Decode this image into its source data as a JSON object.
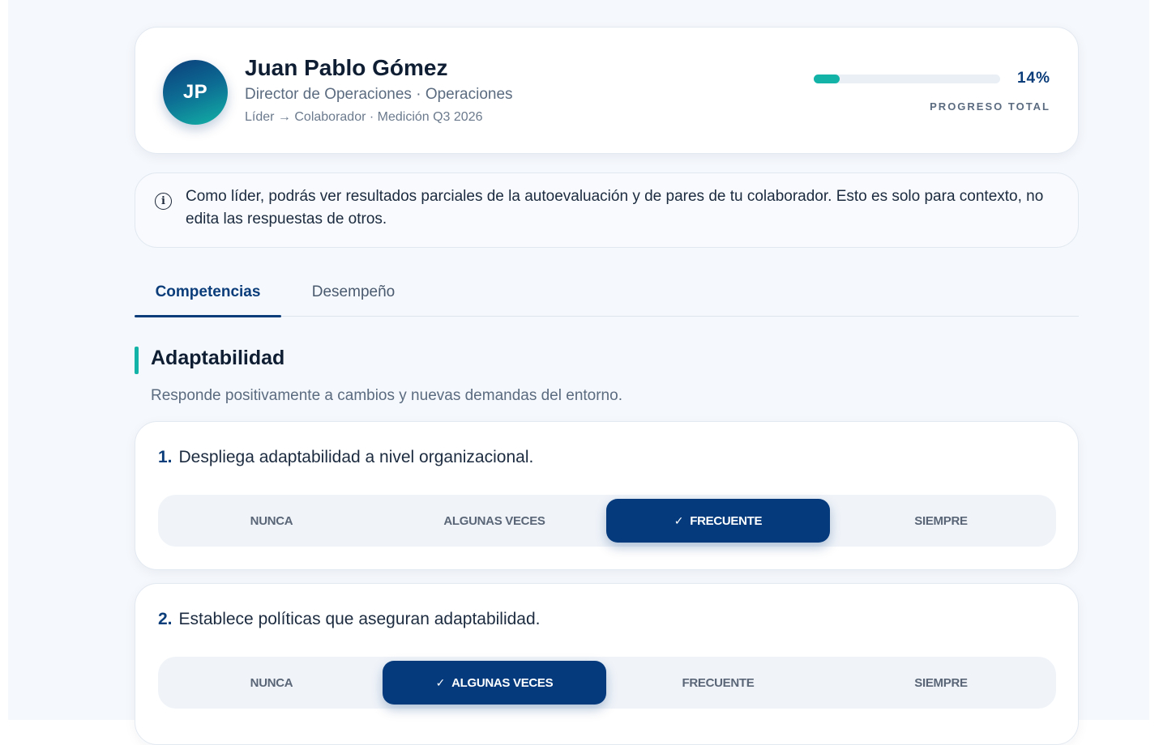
{
  "employee": {
    "initials": "JP",
    "name": "Juan Pablo Gómez",
    "role": "Director de Operaciones · Operaciones",
    "meta": "Líder → Colaborador · Medición Q3 2026"
  },
  "progress": {
    "value_percent": 14,
    "display": "14%",
    "label": "PROGRESO TOTAL"
  },
  "info": {
    "icon": "info-icon",
    "text": "Como líder, podrás ver resultados parciales de la autoevaluación y de pares de tu colaborador. Esto es solo para contexto, no edita las respuestas de otros."
  },
  "tabs": [
    {
      "label": "Competencias",
      "active": true
    },
    {
      "label": "Desempeño",
      "active": false
    }
  ],
  "section": {
    "title": "Adaptabilidad",
    "description": "Responde positivamente a cambios y nuevas demandas del entorno."
  },
  "scale": [
    "NUNCA",
    "ALGUNAS VECES",
    "FRECUENTE",
    "SIEMPRE"
  ],
  "questions": [
    {
      "number": "1.",
      "text": "Despliega adaptabilidad a nivel organizacional.",
      "selected_index": 2
    },
    {
      "number": "2.",
      "text": "Establece políticas que aseguran adaptabilidad.",
      "selected_index": 1
    }
  ],
  "colors": {
    "primary": "#053a7d",
    "accent": "#13b3a8",
    "background": "#f5f8fc"
  }
}
